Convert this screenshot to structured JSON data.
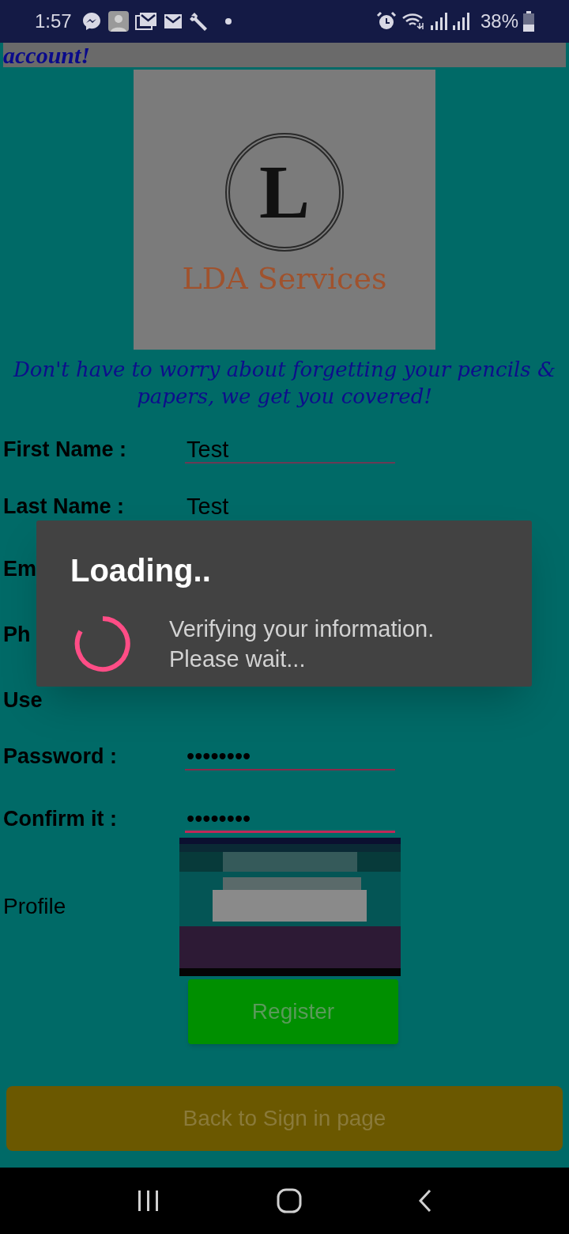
{
  "status_bar": {
    "time": "1:57",
    "battery": "38%"
  },
  "header": {
    "title": "account!"
  },
  "logo": {
    "mark": "L",
    "name": "LDA Services"
  },
  "tagline": "Don't have to worry about forgetting your pencils & papers, we get you covered!",
  "fields": [
    {
      "label": "First Name :",
      "value": "Test",
      "kind": "text",
      "focused": false
    },
    {
      "label": "Last Name :",
      "value": "Test",
      "kind": "text"
    },
    {
      "label": "Em",
      "kind": "hidden"
    },
    {
      "label": "Ph",
      "kind": "hidden"
    },
    {
      "label": "Use",
      "kind": "hidden"
    },
    {
      "label": "Password :",
      "value": "••••••••",
      "kind": "password",
      "focused": false
    },
    {
      "label": "Confirm it :",
      "value": "••••••••",
      "kind": "password",
      "focused": true
    }
  ],
  "profile": {
    "label": "Profile",
    "kind": "picture"
  },
  "register_button": "Register",
  "back_button": "Back to Sign in page",
  "dialog": {
    "title": "Loading..",
    "message": "Verifying your information.\nPlease wait..."
  }
}
